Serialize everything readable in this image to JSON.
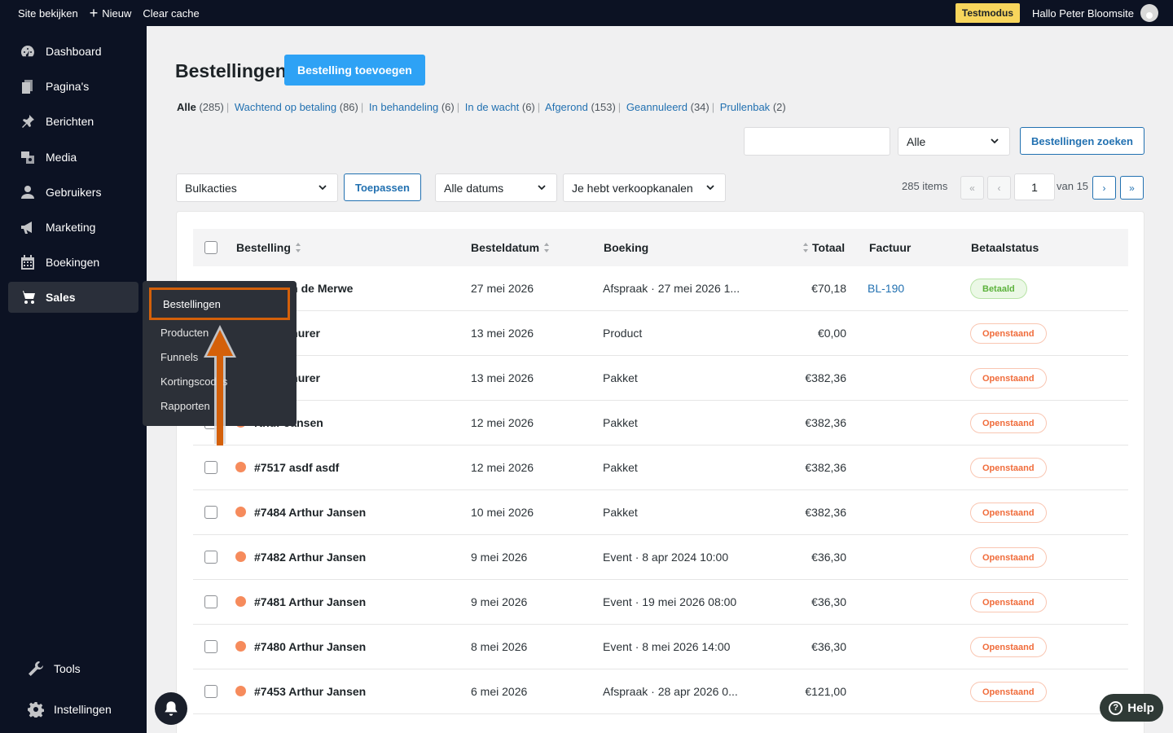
{
  "topbar": {
    "view_site": "Site bekijken",
    "new": "Nieuw",
    "clear_cache": "Clear cache",
    "test_mode": "Testmodus",
    "greeting": "Hallo Peter Bloomsite"
  },
  "sidebar": {
    "items": [
      {
        "label": "Dashboard",
        "icon": "dashboard-icon"
      },
      {
        "label": "Pagina's",
        "icon": "pages-icon"
      },
      {
        "label": "Berichten",
        "icon": "pin-icon"
      },
      {
        "label": "Media",
        "icon": "media-icon"
      },
      {
        "label": "Gebruikers",
        "icon": "user-icon"
      },
      {
        "label": "Marketing",
        "icon": "megaphone-icon"
      },
      {
        "label": "Boekingen",
        "icon": "calendar-icon"
      },
      {
        "label": "Sales",
        "icon": "cart-icon"
      }
    ],
    "bottom": [
      {
        "label": "Tools",
        "icon": "wrench-icon"
      },
      {
        "label": "Instellingen",
        "icon": "gear-icon"
      }
    ]
  },
  "submenu": {
    "items": [
      "Bestellingen",
      "Producten",
      "Funnels",
      "Kortingscodes",
      "Rapporten"
    ]
  },
  "page": {
    "title": "Bestellingen",
    "add_button": "Bestelling toevoegen"
  },
  "status_filters": [
    {
      "label": "Alle",
      "count": "(285)"
    },
    {
      "label": "Wachtend op betaling",
      "count": "(86)"
    },
    {
      "label": "In behandeling",
      "count": "(6)"
    },
    {
      "label": "In de wacht",
      "count": "(6)"
    },
    {
      "label": "Afgerond",
      "count": "(153)"
    },
    {
      "label": "Geannuleerd",
      "count": "(34)"
    },
    {
      "label": "Prullenbak",
      "count": "(2)"
    }
  ],
  "search": {
    "value": "",
    "filter_select": "Alle",
    "search_button": "Bestellingen zoeken"
  },
  "toolbar": {
    "bulk_actions": "Bulkacties",
    "apply": "Toepassen",
    "all_dates": "Alle datums",
    "channels": "Je hebt verkoopkanalen",
    "items_count": "285 items",
    "first": "«",
    "prev": "‹",
    "current_page": "1",
    "of_pages": "van 15",
    "next": "›",
    "last": "»"
  },
  "table": {
    "headers": {
      "order": "Bestelling",
      "date": "Besteldatum",
      "booking": "Boeking",
      "total": "Totaal",
      "invoice": "Factuur",
      "status": "Betaalstatus"
    },
    "rows": [
      {
        "order": "#7538 Pieter van de Merwe",
        "visible_order": "eter van de Merwe",
        "date": "27 mei 2026",
        "booking": "Afspraak · 27 mei 2026 1...",
        "total": "€70,18",
        "invoice": "BL-190",
        "status": "Betaald",
        "paid": true
      },
      {
        "order": "Klaas Schurer",
        "visible_order": "pas Schurer",
        "date": "13 mei 2026",
        "booking": "Product",
        "total": "€0,00",
        "invoice": "",
        "status": "Openstaand",
        "paid": false
      },
      {
        "order": "Klaas Schurer",
        "visible_order": "pas Schurer",
        "date": "13 mei 2026",
        "booking": "Pakket",
        "total": "€382,36",
        "invoice": "",
        "status": "Openstaand",
        "paid": false
      },
      {
        "order": "Arthur Jansen",
        "visible_order": "rthur Jansen",
        "date": "12 mei 2026",
        "booking": "Pakket",
        "total": "€382,36",
        "invoice": "",
        "status": "Openstaand",
        "paid": false
      },
      {
        "order": "#7517 asdf asdf",
        "visible_order": "#7517 asdf asdf",
        "date": "12 mei 2026",
        "booking": "Pakket",
        "total": "€382,36",
        "invoice": "",
        "status": "Openstaand",
        "paid": false
      },
      {
        "order": "#7484 Arthur Jansen",
        "visible_order": "#7484 Arthur Jansen",
        "date": "10 mei 2026",
        "booking": "Pakket",
        "total": "€382,36",
        "invoice": "",
        "status": "Openstaand",
        "paid": false
      },
      {
        "order": "#7482 Arthur Jansen",
        "visible_order": "#7482 Arthur Jansen",
        "date": "9 mei 2026",
        "booking": "Event · 8 apr 2024 10:00",
        "total": "€36,30",
        "invoice": "",
        "status": "Openstaand",
        "paid": false
      },
      {
        "order": "#7481 Arthur Jansen",
        "visible_order": "#7481 Arthur Jansen",
        "date": "9 mei 2026",
        "booking": "Event · 19 mei 2026 08:00",
        "total": "€36,30",
        "invoice": "",
        "status": "Openstaand",
        "paid": false
      },
      {
        "order": "#7480 Arthur Jansen",
        "visible_order": "#7480 Arthur Jansen",
        "date": "8 mei 2026",
        "booking": "Event · 8 mei 2026 14:00",
        "total": "€36,30",
        "invoice": "",
        "status": "Openstaand",
        "paid": false
      },
      {
        "order": "#7453 Arthur Jansen",
        "visible_order": "#7453 Arthur Jansen",
        "date": "6 mei 2026",
        "booking": "Afspraak · 28 apr 2026 0...",
        "total": "€121,00",
        "invoice": "",
        "status": "Openstaand",
        "paid": false
      }
    ]
  },
  "help": {
    "label": "Help"
  },
  "colors": {
    "sidebar_bg": "#0c1223",
    "accent": "#2ea2f5",
    "link": "#2271b1",
    "highlight": "#d4600a",
    "status_open": "#f06c3b",
    "status_paid": "#5cb23c"
  }
}
